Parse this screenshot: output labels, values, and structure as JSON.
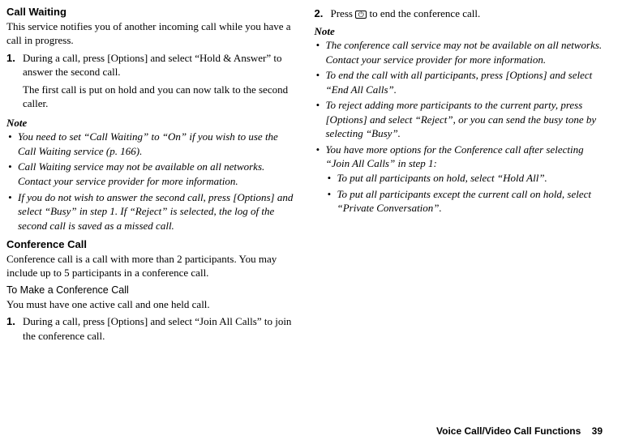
{
  "left": {
    "heading1": "Call Waiting",
    "intro1": "This service notifies you of another incoming call while you have a call in progress.",
    "step1_num": "1.",
    "step1": "During a call, press [Options] and select “Hold & Answer” to answer the second call.",
    "step1_after": "The first call is put on hold and you can now talk to the second caller.",
    "note_head": "Note",
    "notes": [
      "You need to set “Call Waiting” to “On” if you wish to use the Call Waiting service (p. 166).",
      "Call Waiting service may not be available on all networks. Contact your service provider for more information.",
      "If you do not wish to answer the second call, press [Options] and select “Busy” in step 1. If “Reject” is selected, the log of the second call is saved as a missed call."
    ],
    "heading2": "Conference Call",
    "intro2": "Conference call is a call with more than 2 participants. You may include up to 5 participants in a conference call.",
    "subhead": "To Make a Conference Call",
    "subintro": "You must have one active call and one held call.",
    "step2_num": "1.",
    "step2": "During a call, press [Options] and select “Join All Calls” to join the conference call."
  },
  "right": {
    "step_num": "2.",
    "step_pre": "Press ",
    "step_post": " to end the conference call.",
    "note_head": "Note",
    "notes": [
      "The conference call service may not be available on all networks. Contact your service provider for more information.",
      "To end the call with all participants, press [Options] and select “End All Calls”.",
      "To reject adding more participants to the current party, press [Options] and select “Reject”, or you can send the busy tone by selecting “Busy”.",
      "You have more options for the Conference call after selecting “Join All Calls” in step 1:"
    ],
    "subnotes": [
      "To put all participants on hold, select “Hold All”.",
      "To put all participants except the current call on hold, select “Private Conversation”."
    ]
  },
  "footer": {
    "section": "Voice Call/Video Call Functions",
    "page": "39"
  }
}
